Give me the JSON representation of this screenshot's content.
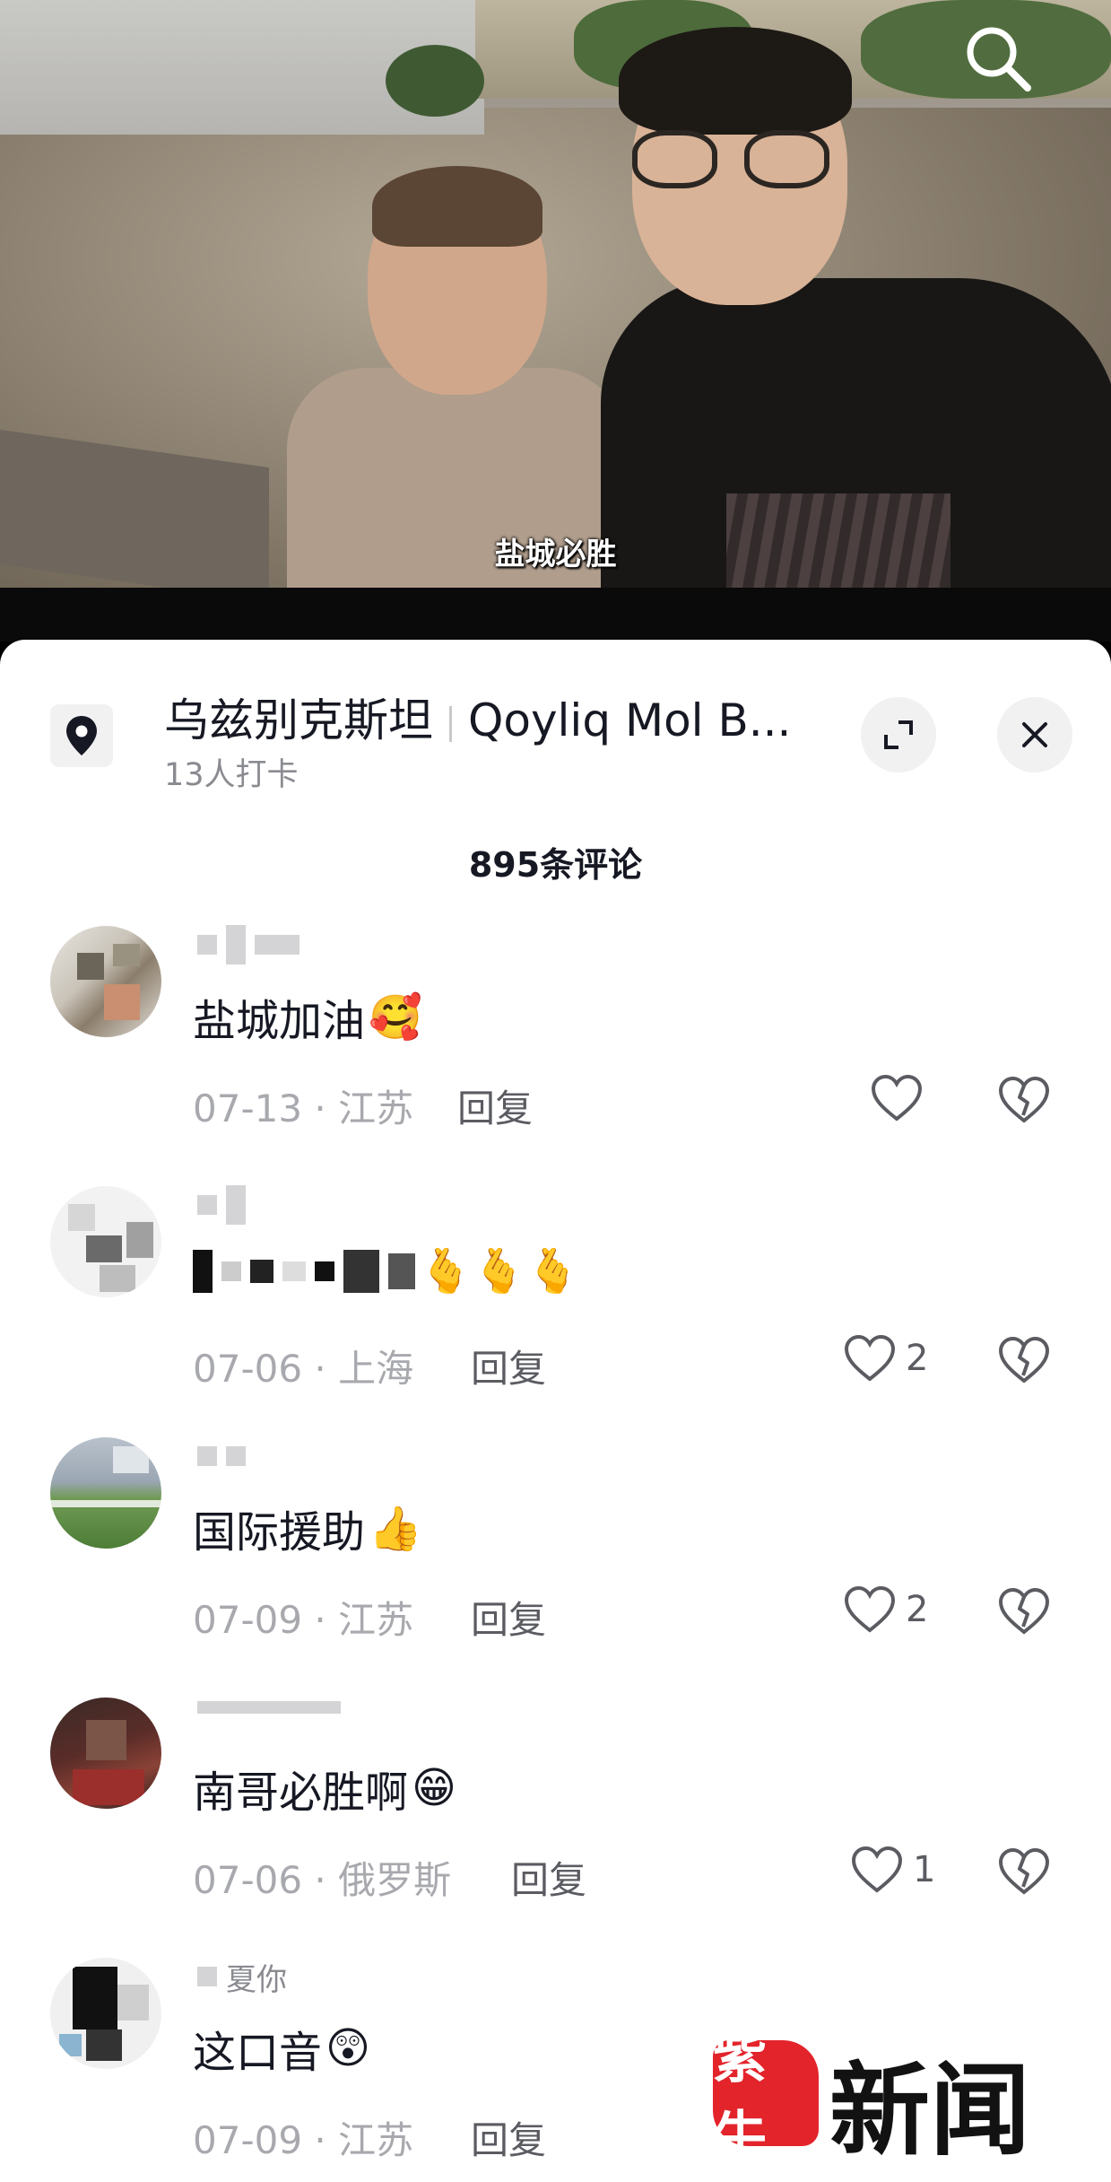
{
  "video": {
    "subtitle": "盐城必胜"
  },
  "location": {
    "name": "乌兹别克斯坦",
    "place": "Qoyliq Mol B...",
    "checkins": "13人打卡"
  },
  "comments_header": {
    "count": "895条评论"
  },
  "comments": [
    {
      "username": "",
      "text": "盐城加油",
      "emoji": "🥰",
      "date_region": "07-13 · 江苏",
      "reply": "回复",
      "likes": ""
    },
    {
      "username": "",
      "text": "",
      "emoji": "🫰🫰🫰",
      "date_region": "07-06 · 上海",
      "reply": "回复",
      "likes": "2"
    },
    {
      "username": "",
      "text": "国际援助",
      "emoji": "👍",
      "date_region": "07-09 · 江苏",
      "reply": "回复",
      "likes": "2"
    },
    {
      "username": "",
      "text": "南哥必胜啊",
      "emoji": "😁",
      "date_region": "07-06 · 俄罗斯",
      "reply": "回复",
      "likes": "1"
    },
    {
      "username": "夏你",
      "text": "这口音",
      "emoji": "😲",
      "date_region": "07-09 · 江苏",
      "reply": "回复",
      "likes": ""
    }
  ],
  "watermark": {
    "badge": "紫牛",
    "text": "新闻"
  },
  "colors": {
    "primary_text": "#161823",
    "secondary_text": "#8a8b91",
    "watermark_red": "#e3242b"
  },
  "icons": [
    "search-icon",
    "location-pin-icon",
    "expand-icon",
    "close-icon",
    "heart-icon",
    "broken-heart-icon"
  ]
}
